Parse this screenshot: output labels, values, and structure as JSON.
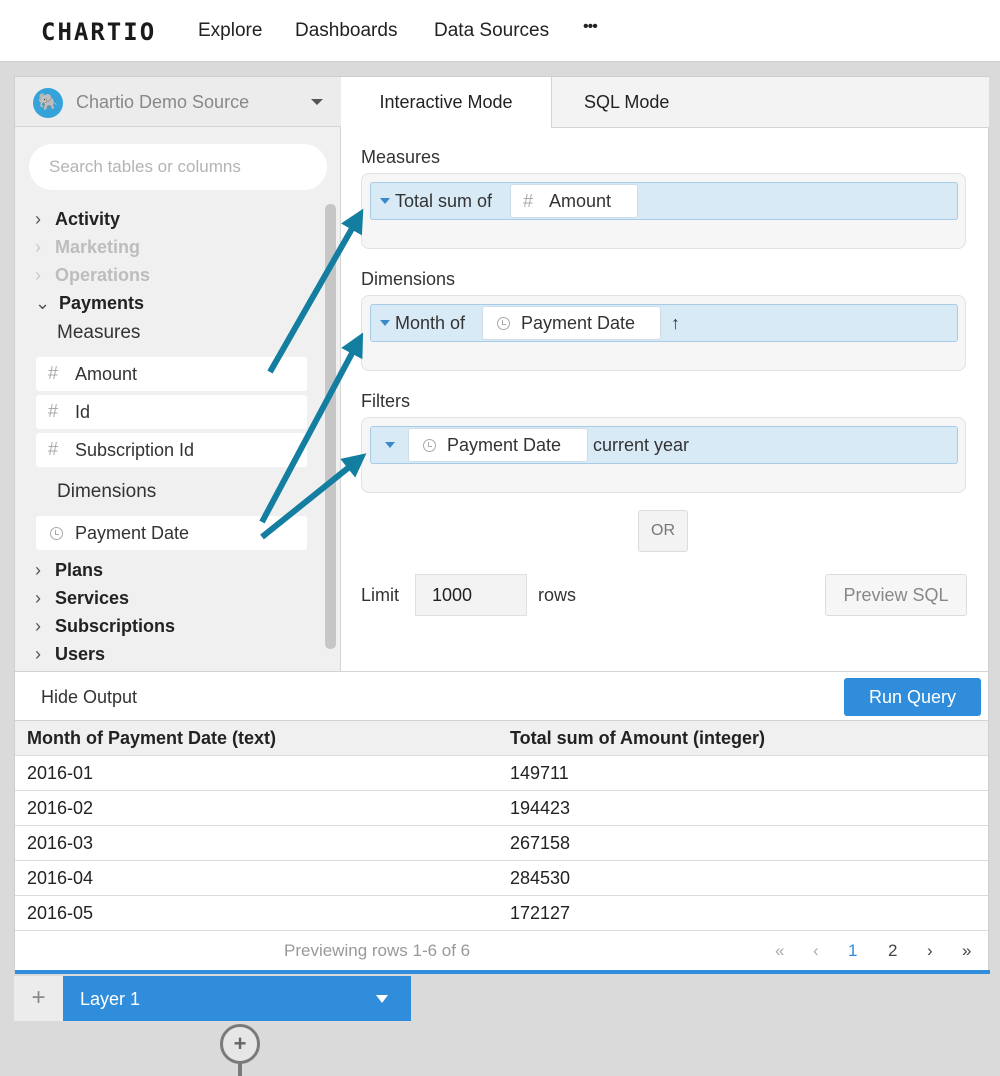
{
  "nav": {
    "logo": "CHARTIO",
    "links": [
      "Explore",
      "Dashboards",
      "Data Sources",
      "•••"
    ]
  },
  "sidebar": {
    "source": "Chartio Demo Source",
    "search_placeholder": "Search tables or columns",
    "tree": {
      "activity": "Activity",
      "marketing": "Marketing",
      "operations": "Operations",
      "payments": "Payments",
      "measures_heading": "Measures",
      "measures": [
        "Amount",
        "Id",
        "Subscription Id"
      ],
      "dimensions_heading": "Dimensions",
      "dimensions": [
        "Payment Date"
      ],
      "plans": "Plans",
      "services": "Services",
      "subscriptions": "Subscriptions",
      "users": "Users"
    }
  },
  "tabs": {
    "interactive": "Interactive Mode",
    "sql": "SQL Mode"
  },
  "builder": {
    "measures_label": "Measures",
    "measure_agg": "Total sum of",
    "measure_column": "Amount",
    "dimensions_label": "Dimensions",
    "dimension_agg": "Month of",
    "dimension_column": "Payment Date",
    "sort_arrow": "↑",
    "filters_label": "Filters",
    "filter_column": "Payment Date",
    "filter_value": "current year",
    "or_button": "OR",
    "limit_label": "Limit",
    "limit_value": "1000",
    "rows_label": "rows",
    "preview_sql": "Preview SQL"
  },
  "output": {
    "hide_output": "Hide Output",
    "run_query": "Run Query",
    "columns": [
      "Month of Payment Date (text)",
      "Total sum of Amount (integer)"
    ],
    "rows": [
      [
        "2016-01",
        "149711"
      ],
      [
        "2016-02",
        "194423"
      ],
      [
        "2016-03",
        "267158"
      ],
      [
        "2016-04",
        "284530"
      ],
      [
        "2016-05",
        "172127"
      ]
    ],
    "pager_label": "Previewing rows 1-6 of 6",
    "pager": {
      "first": "«",
      "prev": "‹",
      "page1": "1",
      "page2": "2",
      "next": "›",
      "last": "»"
    }
  },
  "layers": {
    "add": "+",
    "active": "Layer 1",
    "add_circle": "+"
  },
  "colors": {
    "accent": "#2f8ddb",
    "arrow": "#137ea0",
    "pill_bg": "#d9eaf7"
  },
  "icons": {
    "hash": "#",
    "clock": "clock-icon",
    "source": "postgres-elephant-icon"
  }
}
